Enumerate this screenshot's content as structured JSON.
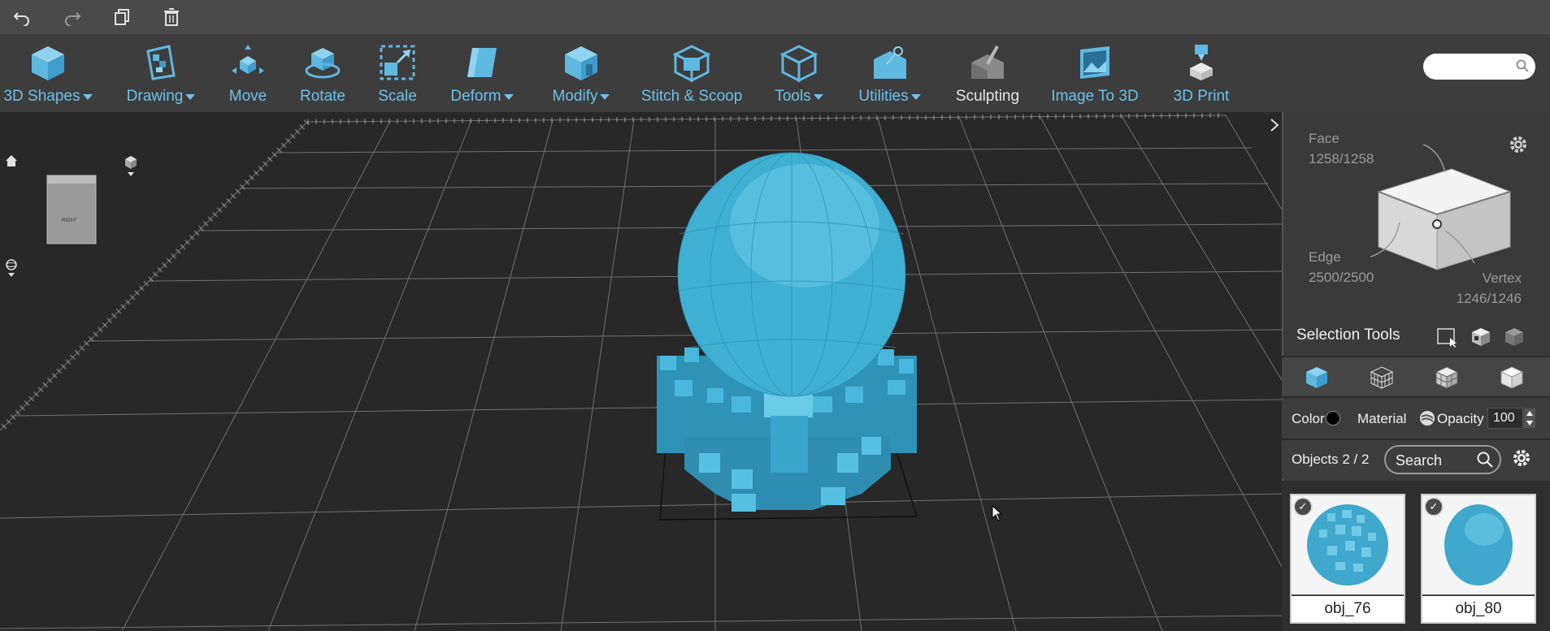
{
  "topbar": {
    "icons": [
      "undo-icon",
      "redo-icon",
      "copy-icon",
      "trash-icon"
    ]
  },
  "toolbar": {
    "tools": [
      {
        "label": "3D Shapes",
        "dropdown": true,
        "icon": "cube-icon"
      },
      {
        "label": "Drawing",
        "dropdown": true,
        "icon": "drawing-icon"
      },
      {
        "label": "Move",
        "dropdown": false,
        "icon": "move-icon"
      },
      {
        "label": "Rotate",
        "dropdown": false,
        "icon": "rotate-icon"
      },
      {
        "label": "Scale",
        "dropdown": false,
        "icon": "scale-icon"
      },
      {
        "label": "Deform",
        "dropdown": true,
        "icon": "deform-icon"
      },
      {
        "label": "Modify",
        "dropdown": true,
        "icon": "modify-icon"
      },
      {
        "label": "Stitch & Scoop",
        "dropdown": false,
        "icon": "stitch-scoop-icon"
      },
      {
        "label": "Tools",
        "dropdown": true,
        "icon": "tools-icon"
      },
      {
        "label": "Utilities",
        "dropdown": true,
        "icon": "utilities-icon"
      },
      {
        "label": "Sculpting",
        "dropdown": false,
        "icon": "sculpting-icon"
      },
      {
        "label": "Image To 3D",
        "dropdown": false,
        "icon": "image-to-3d-icon"
      },
      {
        "label": "3D Print",
        "dropdown": false,
        "icon": "3d-print-icon"
      }
    ]
  },
  "viewport": {
    "view_cube_label": "RIGHT"
  },
  "selection": {
    "face_label": "Face",
    "face_count": "1258/1258",
    "edge_label": "Edge",
    "edge_count": "2500/2500",
    "vertex_label": "Vertex",
    "vertex_count": "1246/1246",
    "tools_title": "Selection Tools"
  },
  "properties": {
    "color_label": "Color",
    "color_value": "#000000",
    "material_label": "Material",
    "opacity_label": "Opacity",
    "opacity_value": "100"
  },
  "objects": {
    "count_label": "Objects 2 / 2",
    "search_placeholder": "Search",
    "items": [
      {
        "name": "obj_76",
        "checked": true
      },
      {
        "name": "obj_80",
        "checked": true
      }
    ]
  },
  "colors": {
    "accent": "#6ec0e8",
    "model": "#3fb0d2"
  }
}
